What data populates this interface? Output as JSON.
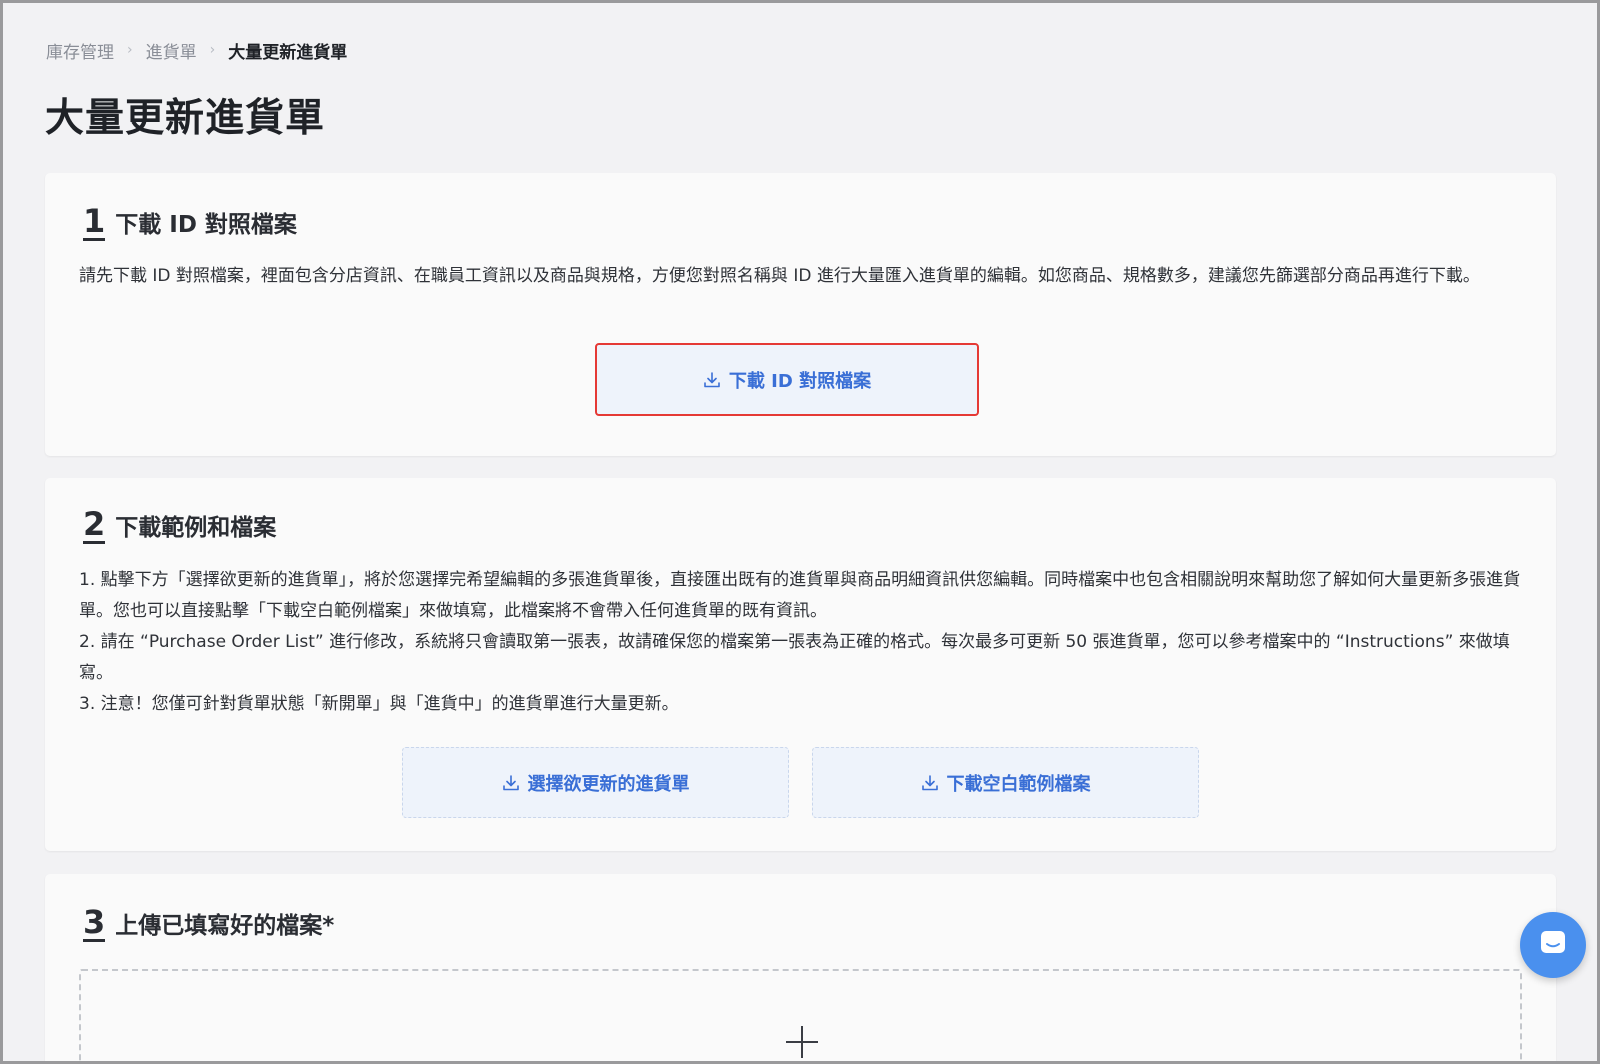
{
  "breadcrumb": {
    "items": [
      "庫存管理",
      "進貨單",
      "大量更新進貨單"
    ],
    "separator": "›"
  },
  "page_title": "大量更新進貨單",
  "step1": {
    "number": "1",
    "title": "下載 ID 對照檔案",
    "description": "請先下載 ID 對照檔案，裡面包含分店資訊、在職員工資訊以及商品與規格，方便您對照名稱與 ID 進行大量匯入進貨單的編輯。如您商品、規格數多，建議您先篩選部分商品再進行下載。",
    "button_label": "下載 ID 對照檔案"
  },
  "step2": {
    "number": "2",
    "title": "下載範例和檔案",
    "lines": [
      "1. 點擊下方「選擇欲更新的進貨單」，將於您選擇完希望編輯的多張進貨單後，直接匯出既有的進貨單與商品明細資訊供您編輯。同時檔案中也包含相關說明來幫助您了解如何大量更新多張進貨單。您也可以直接點擊「下載空白範例檔案」來做填寫，此檔案將不會帶入任何進貨單的既有資訊。",
      "2. 請在 “Purchase Order List” 進行修改，系統將只會讀取第一張表，故請確保您的檔案第一張表為正確的格式。每次最多可更新 50 張進貨單，您可以參考檔案中的 “Instructions” 來做填寫。",
      "3. 注意！您僅可針對貨單狀態「新開單」與「進貨中」的進貨單進行大量更新。"
    ],
    "button_select_label": "選擇欲更新的進貨單",
    "button_blank_label": "下載空白範例檔案"
  },
  "step3": {
    "number": "3",
    "title": "上傳已填寫好的檔案*"
  },
  "colors": {
    "accent": "#3a6fd6",
    "highlight_border": "#e53935",
    "chat_button": "#4a90ee"
  },
  "icons": {
    "download": "download-icon",
    "plus": "plus-icon",
    "chat": "chat-icon"
  }
}
